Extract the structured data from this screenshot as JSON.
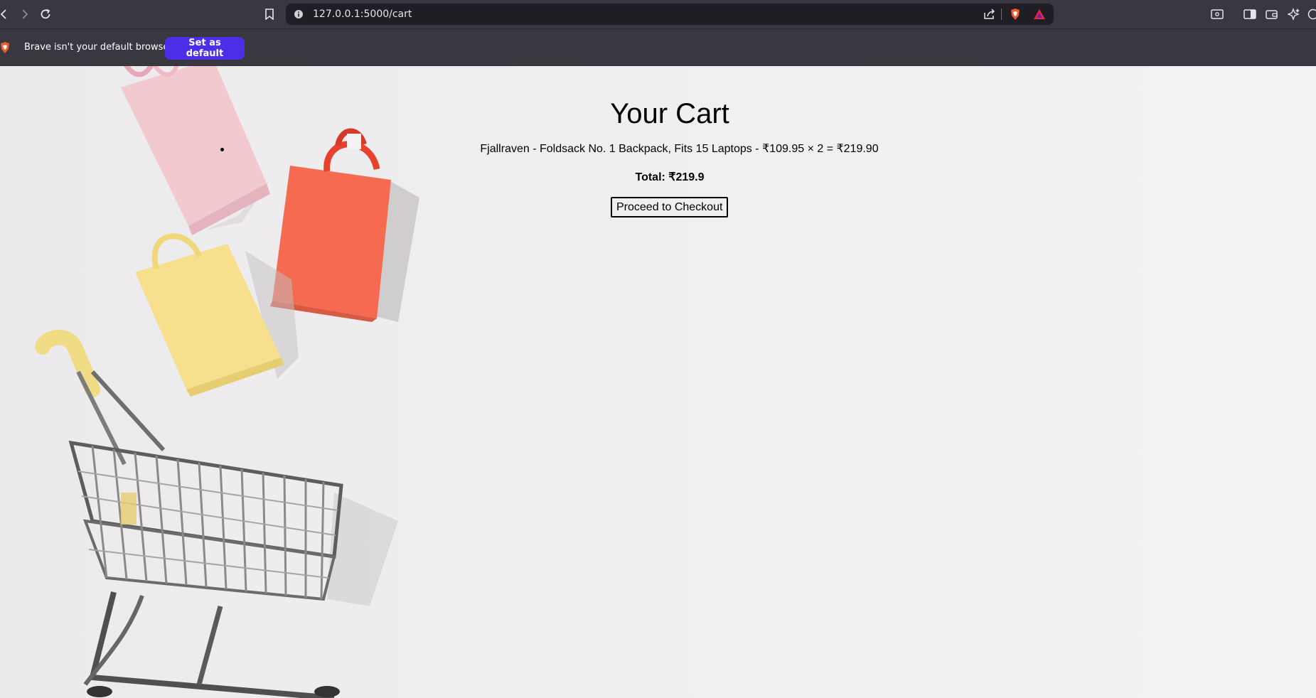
{
  "browser": {
    "url": "127.0.0.1:5000/cart",
    "infobar": {
      "message": "Brave isn't your default browser",
      "button_label": "Set as default"
    },
    "colors": {
      "toolbar": "#393840",
      "urlbar": "#1f1e24",
      "accent_button": "#4c2ee6"
    }
  },
  "page": {
    "title": "Your Cart",
    "items": [
      {
        "text": "Fjallraven - Foldsack No. 1 Backpack, Fits 15 Laptops - ₹109.95 × 2 = ₹219.90"
      }
    ],
    "total": "Total: ₹219.9",
    "checkout_label": "Proceed to Checkout"
  },
  "icons": [
    "back-icon",
    "forward-icon",
    "reload-icon",
    "bookmark-icon",
    "site-info-icon",
    "share-icon",
    "brave-shields-icon",
    "brave-rewards-icon",
    "reader-mode-icon",
    "sidebar-icon",
    "wallet-icon",
    "leo-ai-icon",
    "vpn-icon",
    "brave-lion-icon"
  ]
}
